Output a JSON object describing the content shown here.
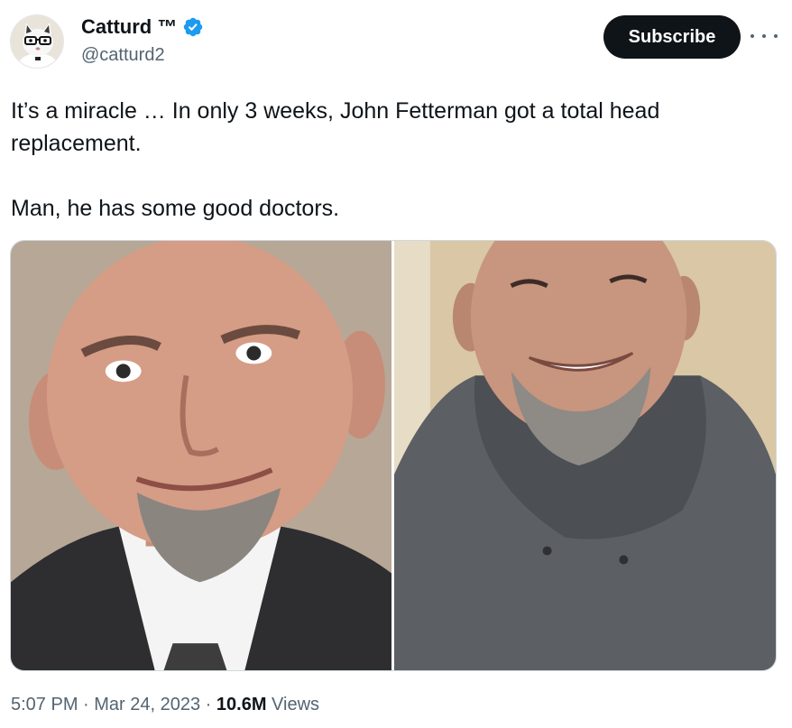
{
  "author": {
    "display_name": "Catturd ™",
    "handle": "@catturd2",
    "verified": true,
    "verified_color": "#1d9bf0"
  },
  "actions": {
    "subscribe_label": "Subscribe",
    "more_icon": "more-horizontal-icon"
  },
  "tweet": {
    "text_line1": "It’s a miracle … In only 3 weeks, John Fetterman got a total head replacement.",
    "text_line2": "Man, he has some good doctors.",
    "media": [
      {
        "icon": "photo"
      },
      {
        "icon": "photo"
      }
    ]
  },
  "meta": {
    "time": "5:07 PM",
    "separator1": " · ",
    "date": "Mar 24, 2023",
    "separator2": " · ",
    "views_count": "10.6M",
    "views_label": " Views"
  },
  "colors": {
    "text_primary": "#0f1419",
    "text_secondary": "#536471",
    "button_bg": "#0f1419",
    "border": "#cfd9de"
  }
}
